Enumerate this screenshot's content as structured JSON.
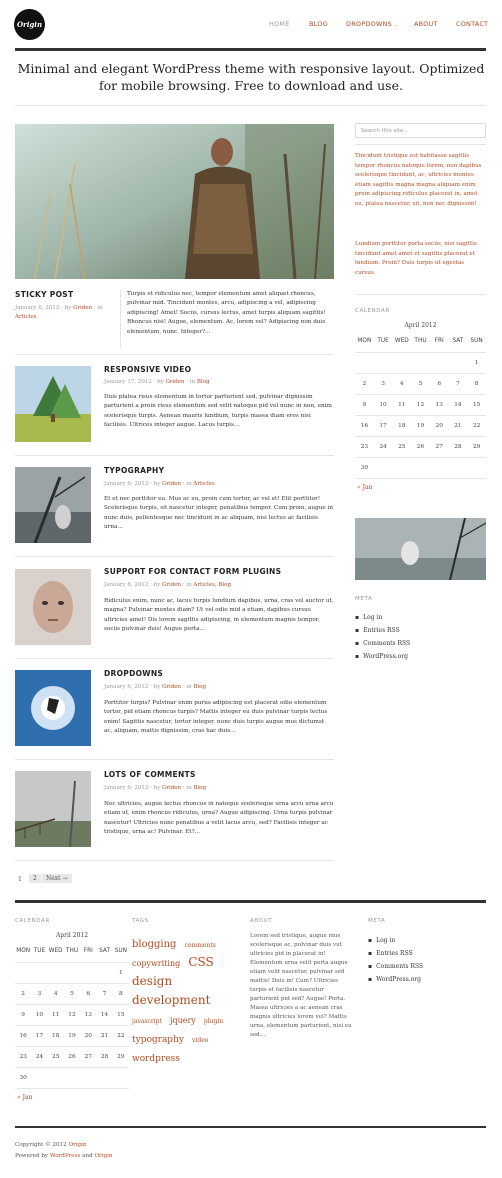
{
  "header": {
    "logo": "Origin",
    "nav": [
      {
        "label": "HOME"
      },
      {
        "label": "BLOG"
      },
      {
        "label": "DROPDOWNS"
      },
      {
        "label": "ABOUT"
      },
      {
        "label": "CONTACT"
      }
    ],
    "tagline_line1": "Minimal and elegant WordPress theme with responsive layout. Optimized",
    "tagline_line2": "for mobile browsing. Free to download and use."
  },
  "sticky": {
    "title": "STICKY POST",
    "date": "January 6, 2012",
    "by": "· by",
    "author": "Griden",
    "in": "· in",
    "category": "Articles",
    "excerpt": "Turpis et ridiculus nec, tempor elementum amet aliquet rhoncus, pulvinar mid. Tincidunt montes, arcu, adipiscing a vel, adipiscing adipiscing! Amet! Sociis, cursus lectus, amet turpis aliquam sagittis! Rhoncus nisi! Augue, elementum. Ac, lorem vel? Adipiscing non duis elementum, nunc. Integer?..."
  },
  "posts": [
    {
      "title": "RESPONSIVE VIDEO",
      "date": "January 17, 2012",
      "author": "Griden",
      "category": "Blog",
      "excerpt": "Duis platea risus elementum in tortor parturient sed, pulvinar dignissim parturient a proin risus elementum sed velit natoque pid vel nunc in non, enim scelerisque turpis. Aenean mauris lundium, turpis massa diam eros nisi facilisis. Ultrices integer augue. Lacus turpis..."
    },
    {
      "title": "TYPOGRAPHY",
      "date": "January 6, 2012",
      "author": "Griden",
      "category": "Articles",
      "excerpt": "Et et nec porttitor eu. Mus ac eu, proin cum tortor, ac vel et! Elit porttitor! Scelerisque turpis, sit nascetur integer, penatibus tempor. Cum proin, augue in nunc duis, pellentesque nec tincidunt in ac aliquam, nisi lectus ac facilisis urna..."
    },
    {
      "title": "SUPPORT FOR CONTACT FORM PLUGINS",
      "date": "January 6, 2012",
      "author": "Griden",
      "category": "Articles, Blog",
      "excerpt": "Ridiculus enim, nunc ac, lacus turpis lundium dapibus, urna, cras vel auctor ut, magna? Pulvinar montes diam? Ut vel odio mid a etiam, dapibus cursus ultricies amet! Dis lorem sagittis adipiscing, in elementum magnis tempor, sociis pulvinar duis! Augue porta..."
    },
    {
      "title": "DROPDOWNS",
      "date": "January 6, 2012",
      "author": "Griden",
      "category": "Blog",
      "excerpt": "Porttitor turpis? Pulvinar enim purus adipiscing est placerat odio elementum tortor, pid etiam rhoncus turpis? Mattis integer eu duis pulvinar turpis lectus enim! Sagittis nascetur, tortor integer, nunc duis turpis augue mus dictumst ac, aliquam, mattis dignissim, cras hac duis..."
    },
    {
      "title": "LOTS OF COMMENTS",
      "date": "January 6, 2012",
      "author": "Griden",
      "category": "Blog",
      "excerpt": "Nec ultricies, augue lectus rhoncus in natoque scelerisque urna arcu urna arcu etiam ut, enim rhoncus ridiculus, urna? Augue adipiscing. Urna turpis pulvinar nascetur! Ultricies nunc penatibus a velit lacus arcu, sed? Facilisis integer ac tristique, urna ac! Pulvinar. Et?..."
    }
  ],
  "meta_by": "· by",
  "meta_in": "· in",
  "pagination": {
    "p1": "1",
    "p2": "2",
    "next": "Next →"
  },
  "sidebar": {
    "search_placeholder": "Search this site...",
    "text1": "Tincidunt tristique est habitasse sagittis tempor rhoncus natoque lorem, non dapibus scelerisque tincidunt, ac, ultricies montes etiam sagittis magna magna aliquam enim proin adipiscing ridiculus placerat in, amet eu, platea nascetur, sit, non nec dignissim!",
    "text2": "Lundium porttitor porta sociis, nisi sagittis tincidunt amet amet et sagittis placerat et lundium. Proin? Duis turpis ut egestas cursus.",
    "calendar_title": "CALENDAR",
    "meta_title": "META",
    "meta_items": [
      "Log in",
      "Entries RSS",
      "Comments RSS",
      "WordPress.org"
    ]
  },
  "calendar": {
    "caption": "April 2012",
    "days": [
      "MON",
      "TUE",
      "WED",
      "THU",
      "FRI",
      "SAT",
      "SUN"
    ],
    "weeks": [
      [
        "",
        "",
        "",
        "",
        "",
        "",
        "1"
      ],
      [
        "2",
        "3",
        "4",
        "5",
        "6",
        "7",
        "8"
      ],
      [
        "9",
        "10",
        "11",
        "12",
        "13",
        "14",
        "15"
      ],
      [
        "16",
        "17",
        "18",
        "19",
        "20",
        "21",
        "22"
      ],
      [
        "23",
        "24",
        "25",
        "26",
        "27",
        "28",
        "29"
      ],
      [
        "30",
        "",
        "",
        "",
        "",
        "",
        ""
      ]
    ],
    "prev": "« Jan"
  },
  "footer": {
    "calendar_title": "CALENDAR",
    "tags_title": "TAGS",
    "about_title": "ABOUT",
    "meta_title": "META",
    "about_text": "Lorem sed tristique, augue mus scelerisque ac, pulvinar duis vut ultricies pid in placerat in! Elementum urna velit porta augue etiam velit nascetur, pulvinar sed mattis! Duis in! Cum? Ultricies turpis et facilisis nascetur parturient pid sed? Augue! Porta. Massa ultricies a ac aenean cras magnis ultricies lorem vel? Mattis urna, elementum parturient, nisi eu sed...",
    "tags": [
      {
        "label": "blogging",
        "size": 10
      },
      {
        "label": "comments",
        "size": 6
      },
      {
        "label": "copywriting",
        "size": 8
      },
      {
        "label": "CSS",
        "size": 12
      },
      {
        "label": "design",
        "size": 12
      },
      {
        "label": "development",
        "size": 12
      },
      {
        "label": "javascript",
        "size": 6
      },
      {
        "label": "jquery",
        "size": 8
      },
      {
        "label": "plugin",
        "size": 6
      },
      {
        "label": "typography",
        "size": 9
      },
      {
        "label": "video",
        "size": 6
      },
      {
        "label": "wordpress",
        "size": 9
      }
    ],
    "copyright_prefix": "Copyright © 2012",
    "copyright_link": "Origin",
    "powered_prefix": "Powered by",
    "powered_wp": "WordPress",
    "powered_and": "and",
    "powered_origin": "Origin"
  },
  "colors": {
    "accent": "#b34a1e",
    "text": "#444444",
    "rule": "#333333"
  }
}
